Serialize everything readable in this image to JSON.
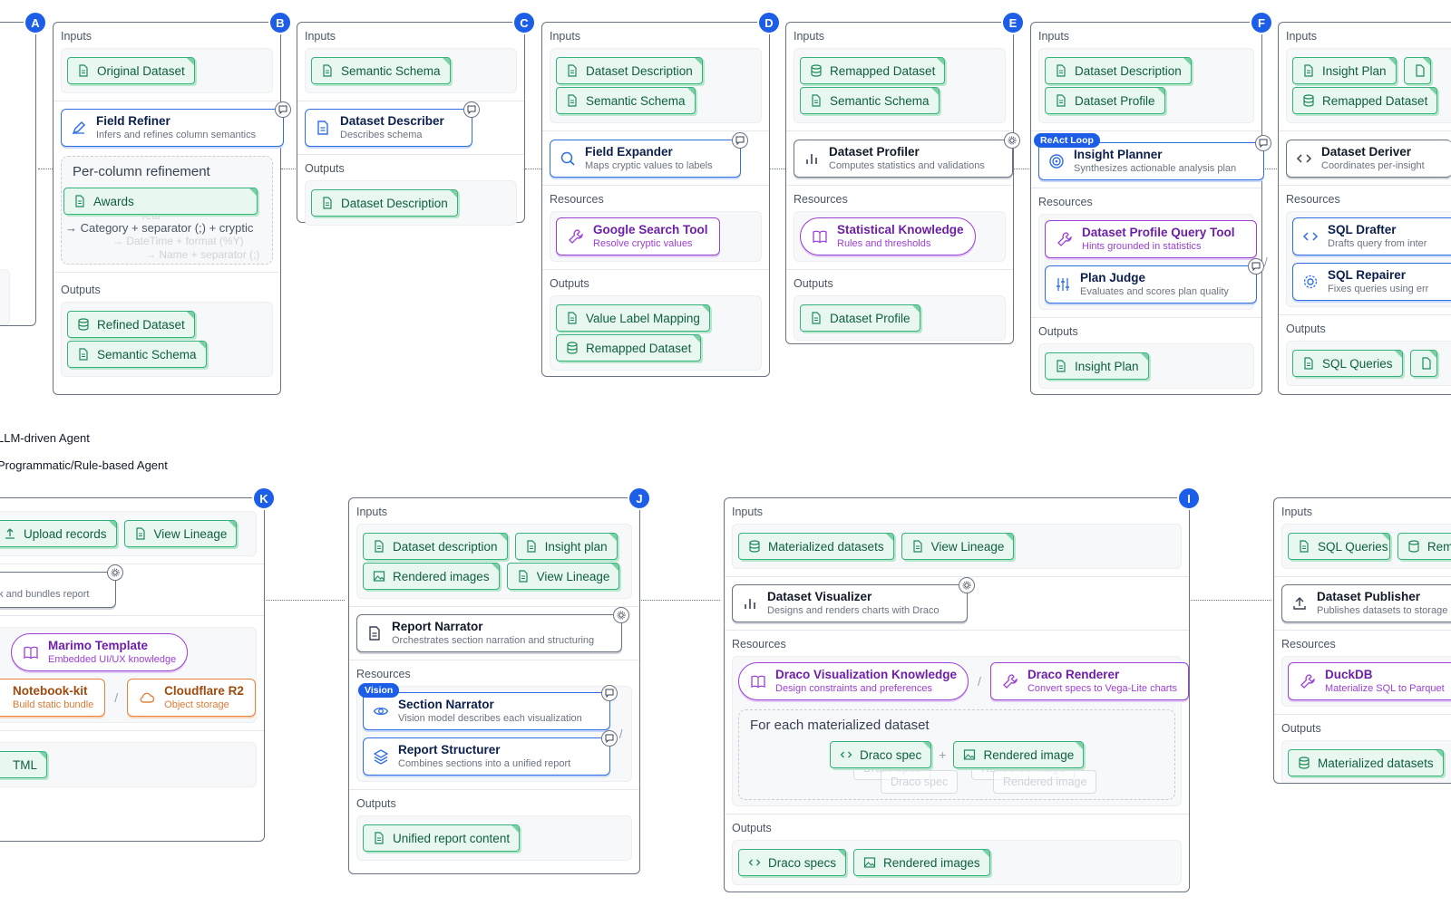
{
  "labels": {
    "inputs": "Inputs",
    "outputs": "Outputs",
    "resources": "Resources"
  },
  "legend": {
    "llm": "LLM-driven Agent",
    "prog": "Programmatic/Rule-based Agent"
  },
  "panels": {
    "A": {
      "letter": "A",
      "partial": "y"
    },
    "B": {
      "letter": "B",
      "inputs": [
        "Original Dataset"
      ],
      "agent": {
        "title": "Field Refiner",
        "subtitle": "Infers and refines column semantics"
      },
      "group_title": "Per-column refinement",
      "group_chip": "Awards",
      "group_line1": "→ Category + separator (;) + cryptic",
      "ghost_year": "Year",
      "ghost_line2": "→ DateTime + format (%Y)",
      "ghost_line3": "→ Name + separator (;)",
      "outputs": [
        "Refined Dataset",
        "Semantic Schema"
      ]
    },
    "C": {
      "letter": "C",
      "inputs": [
        "Semantic Schema"
      ],
      "agent": {
        "title": "Dataset Describer",
        "subtitle": "Describes schema"
      },
      "outputs": [
        "Dataset Description"
      ]
    },
    "D": {
      "letter": "D",
      "inputs": [
        "Dataset Description",
        "Semantic Schema"
      ],
      "agent": {
        "title": "Field Expander",
        "subtitle": "Maps cryptic values to labels"
      },
      "resources": [
        {
          "title": "Google Search Tool",
          "subtitle": "Resolve cryptic values"
        }
      ],
      "outputs": [
        "Value Label Mapping",
        "Remapped Dataset"
      ]
    },
    "E": {
      "letter": "E",
      "inputs": [
        "Remapped Dataset",
        "Semantic Schema"
      ],
      "agent": {
        "title": "Dataset Profiler",
        "subtitle": "Computes statistics and validations"
      },
      "resources": [
        {
          "title": "Statistical Knowledge",
          "subtitle": "Rules and thresholds"
        }
      ],
      "outputs": [
        "Dataset Profile"
      ]
    },
    "F": {
      "letter": "F",
      "inputs": [
        "Dataset Description",
        "Dataset Profile"
      ],
      "tag": "ReAct Loop",
      "agent": {
        "title": "Insight Planner",
        "subtitle": "Synthesizes actionable analysis plan"
      },
      "resources": [
        {
          "title": "Dataset Profile Query Tool",
          "subtitle": "Hints grounded in statistics"
        },
        {
          "title": "Plan Judge",
          "subtitle": "Evaluates and scores plan quality"
        }
      ],
      "sep": "/",
      "outputs": [
        "Insight Plan"
      ]
    },
    "G": {
      "inputs": [
        "Insight Plan",
        "Remapped Dataset"
      ],
      "agent": {
        "title": "Dataset Deriver",
        "subtitle": "Coordinates per-insight"
      },
      "resources": [
        {
          "title": "SQL Drafter",
          "subtitle": "Drafts query from inter"
        },
        {
          "title": "SQL Repairer",
          "subtitle": "Fixes queries using err"
        }
      ],
      "outputs": [
        "SQL Queries"
      ]
    },
    "K": {
      "letter": "K",
      "inputs": [
        "Upload records",
        "View Lineage"
      ],
      "agent_sub": "ok and bundles report",
      "resources": [
        {
          "title": "Marimo Template",
          "subtitle": "Embedded UI/UX knowledge"
        },
        {
          "title": "Notebook-kit",
          "subtitle": "Build static bundle"
        },
        {
          "title": "Cloudflare R2",
          "subtitle": "Object storage"
        }
      ],
      "sep": "/",
      "outputs": [
        "TML"
      ]
    },
    "J": {
      "letter": "J",
      "inputs": [
        "Dataset description",
        "Insight plan",
        "Rendered images",
        "View Lineage"
      ],
      "agent": {
        "title": "Report Narrator",
        "subtitle": "Orchestrates section narration and structuring"
      },
      "tag": "Vision",
      "resources": [
        {
          "title": "Section Narrator",
          "subtitle": "Vision model describes each visualization"
        },
        {
          "title": "Report Structurer",
          "subtitle": "Combines sections into a unified report"
        }
      ],
      "sep": "/",
      "outputs": [
        "Unified report content"
      ]
    },
    "I": {
      "letter": "I",
      "inputs": [
        "Materialized datasets",
        "View Lineage"
      ],
      "agent": {
        "title": "Dataset Visualizer",
        "subtitle": "Designs and renders charts with Draco"
      },
      "resources": [
        {
          "title": "Draco Visualization Knowledge",
          "subtitle": "Design constraints and preferences"
        },
        {
          "title": "Draco Renderer",
          "subtitle": "Convert specs to Vega-Lite charts"
        }
      ],
      "sep": "/",
      "group_title": "For each materialized dataset",
      "group_chips": [
        "Draco spec",
        "Rendered image"
      ],
      "plus": "+",
      "outputs": [
        "Draco specs",
        "Rendered images"
      ]
    },
    "H": {
      "inputs": [
        "SQL Queries",
        "Rem"
      ],
      "agent": {
        "title": "Dataset Publisher",
        "subtitle": "Publishes datasets to storage"
      },
      "resources": [
        {
          "title": "DuckDB",
          "subtitle": "Materialize SQL to Parquet"
        }
      ],
      "outputs": [
        "Materialized datasets"
      ]
    }
  }
}
